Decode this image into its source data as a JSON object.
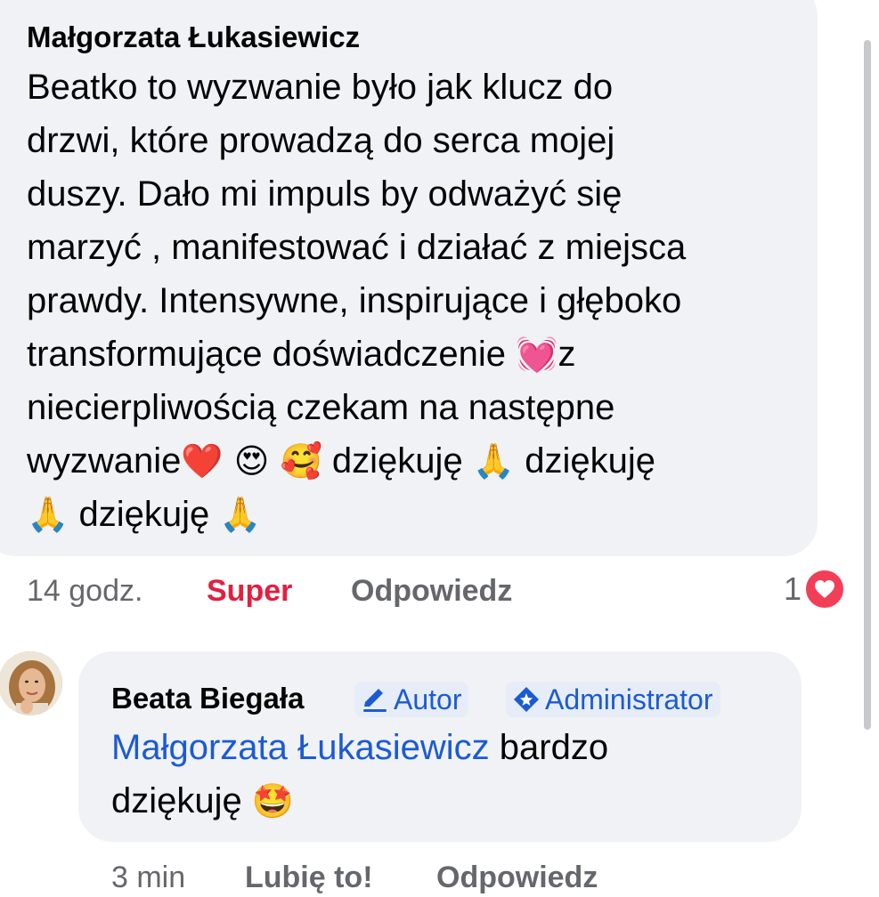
{
  "comment": {
    "author": "Małgorzata Łukasiewicz",
    "lines": [
      "Beatko to wyzwanie było jak klucz do",
      "drzwi, które prowadzą do serca mojej",
      "duszy. Dało mi impuls by odważyć się",
      "marzyć , manifestować i działać z miejsca",
      "prawdy. Intensywne, inspirujące i głęboko"
    ],
    "line6_text": "transformujące doświadczenie ",
    "line6_emoji": "💓",
    "line6_tail": "z",
    "line7": "niecierpliwością czekam na następne",
    "line8_text": "wyzwanie",
    "line8_emojis": "❤️ 😍 🥰",
    "line8_thanks1": " dziękuję ",
    "pray_emoji": "🙏",
    "line8_thanks2": " dziękuję",
    "line9_thanks": " dziękuję ",
    "time": "14 godz.",
    "like_label": "Super",
    "reply_label": "Odpowiedz",
    "reaction_count": "1",
    "reaction_icon": "heart-icon",
    "like_color": "#e41e3f"
  },
  "reply": {
    "author": "Beata Biegała",
    "badge_author": "Autor",
    "badge_admin": "Administrator",
    "mention": "Małgorzata Łukasiewicz",
    "text1": " bardzo",
    "text2": "dziękuję ",
    "emoji": "🤩",
    "time": "3 min",
    "like_label": "Lubię to!",
    "reply_label": "Odpowiedz",
    "link_color": "#1b5bd2"
  }
}
